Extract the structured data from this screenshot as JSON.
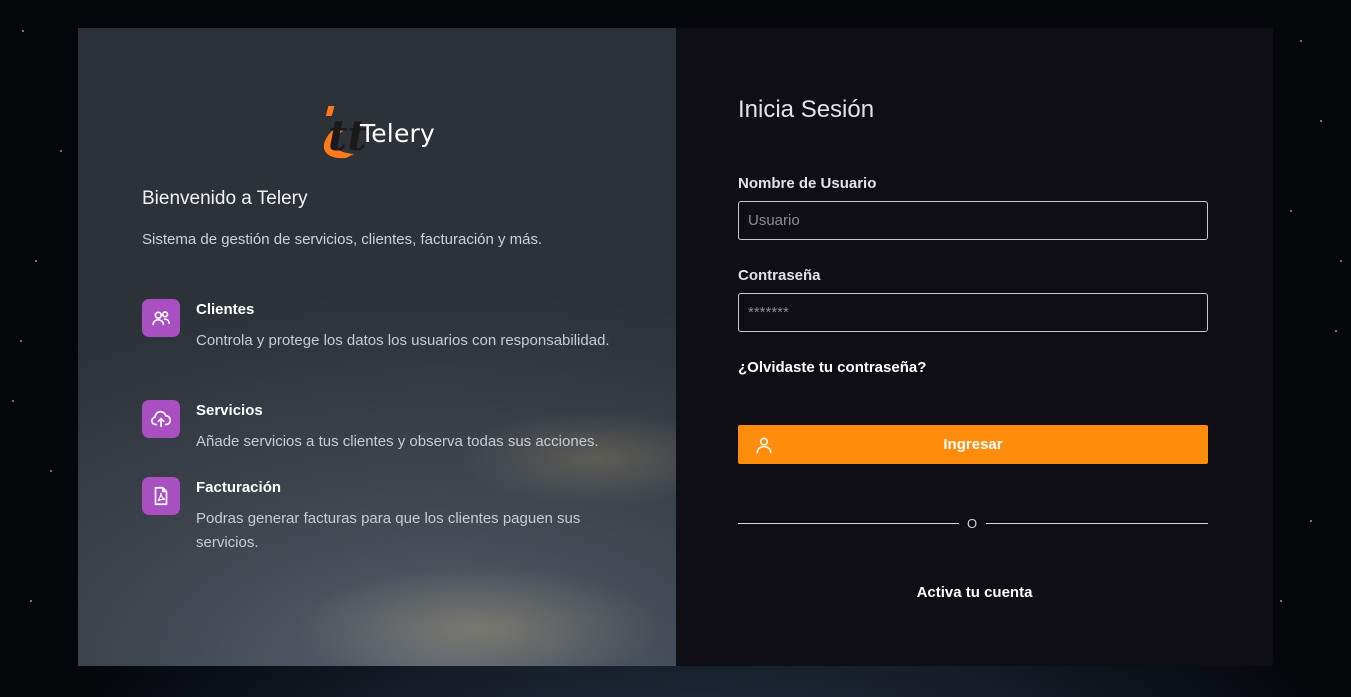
{
  "brand": {
    "name": "Telery",
    "logo_letters": "tt",
    "accent_color": "#ff8c0a",
    "feature_icon_color": "#a84fc2"
  },
  "intro": {
    "welcome": "Bienvenido a Telery",
    "subtitle": "Sistema de gestión de servicios, clientes, facturación y más."
  },
  "features": [
    {
      "icon": "users-icon",
      "title": "Clientes",
      "description": "Controla y protege los datos los usuarios con responsabilidad."
    },
    {
      "icon": "cloud-upload-icon",
      "title": "Servicios",
      "description": "Añade servicios a tus clientes y observa todas sus acciones."
    },
    {
      "icon": "pdf-file-icon",
      "title": "Facturación",
      "description": "Podras generar facturas para que los clientes paguen sus servicios."
    }
  ],
  "login": {
    "title": "Inicia Sesión",
    "username_label": "Nombre de Usuario",
    "username_placeholder": "Usuario",
    "password_label": "Contraseña",
    "password_placeholder": "*******",
    "forgot_link": "¿Olvidaste tu contraseña?",
    "submit_label": "Ingresar",
    "submit_icon": "user-icon",
    "divider_text": "O",
    "activate_link": "Activa tu cuenta"
  }
}
